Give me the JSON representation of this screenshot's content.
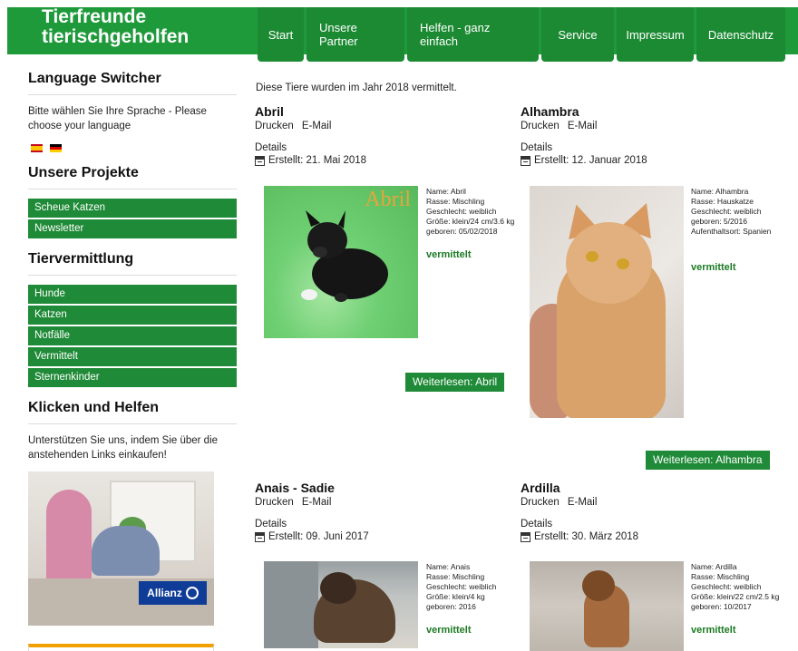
{
  "header": {
    "logo_line1": "Tierfreunde",
    "logo_line2": "tierischgeholfen",
    "nav": [
      "Start",
      "Unsere Partner",
      "Helfen - ganz einfach",
      "Service",
      "Impressum",
      "Datenschutz"
    ]
  },
  "sidebar": {
    "language_title": "Language Switcher",
    "language_text": "Bitte wählen Sie Ihre Sprache - Please choose your language",
    "flags": [
      "spanish-flag-icon",
      "german-flag-icon"
    ],
    "projects_title": "Unsere Projekte",
    "projects": [
      "Scheue Katzen",
      "Newsletter"
    ],
    "adoption_title": "Tiervermittlung",
    "adoption": [
      "Hunde",
      "Katzen",
      "Notfälle",
      "Vermittelt",
      "Sternenkinder"
    ],
    "click_title": "Klicken und Helfen",
    "click_text": "Unterstützen Sie uns, indem Sie über die anstehenden Links einkaufen!",
    "ad_brand": "Allianz"
  },
  "main": {
    "intro": "Diese Tiere wurden im Jahr 2018 vermittelt.",
    "action_print": "Drucken",
    "action_email": "E-Mail",
    "details": "Details",
    "entries": [
      {
        "title": "Abril",
        "created": "Erstellt: 21. Mai 2018",
        "info": [
          "Name: Abril",
          "Rasse: Mischling",
          "Geschlecht: weiblich",
          "Größe: klein/24 cm/3.6 kg",
          "geboren: 05/02/2018"
        ],
        "status": "vermittelt",
        "readmore": "Weiterlesen: Abril",
        "photo_label": "Abril"
      },
      {
        "title": "Alhambra",
        "created": "Erstellt: 12. Januar 2018",
        "info": [
          "Name: Alhambra",
          "Rasse: Hauskatze",
          "Geschlecht: weiblich",
          "geboren: 5/2016",
          "Aufenthaltsort: Spanien"
        ],
        "status": "vermittelt",
        "readmore": "Weiterlesen: Alhambra"
      },
      {
        "title": "Anais - Sadie",
        "created": "Erstellt: 09. Juni 2017",
        "info": [
          "Name: Anais",
          "Rasse: Mischling",
          "Geschlecht: weiblich",
          "Größe: klein/4 kg",
          "geboren: 2016"
        ],
        "status": "vermittelt"
      },
      {
        "title": "Ardilla",
        "created": "Erstellt: 30. März 2018",
        "info": [
          "Name: Ardilla",
          "Rasse: Mischling",
          "Geschlecht: weiblich",
          "Größe: klein/22 cm/2.5 kg",
          "geboren: 10/2017"
        ],
        "status": "vermittelt"
      }
    ]
  },
  "colors": {
    "brand_green": "#1f9a3a",
    "menu_green": "#1f8a37",
    "status_green": "#1c7a23"
  }
}
